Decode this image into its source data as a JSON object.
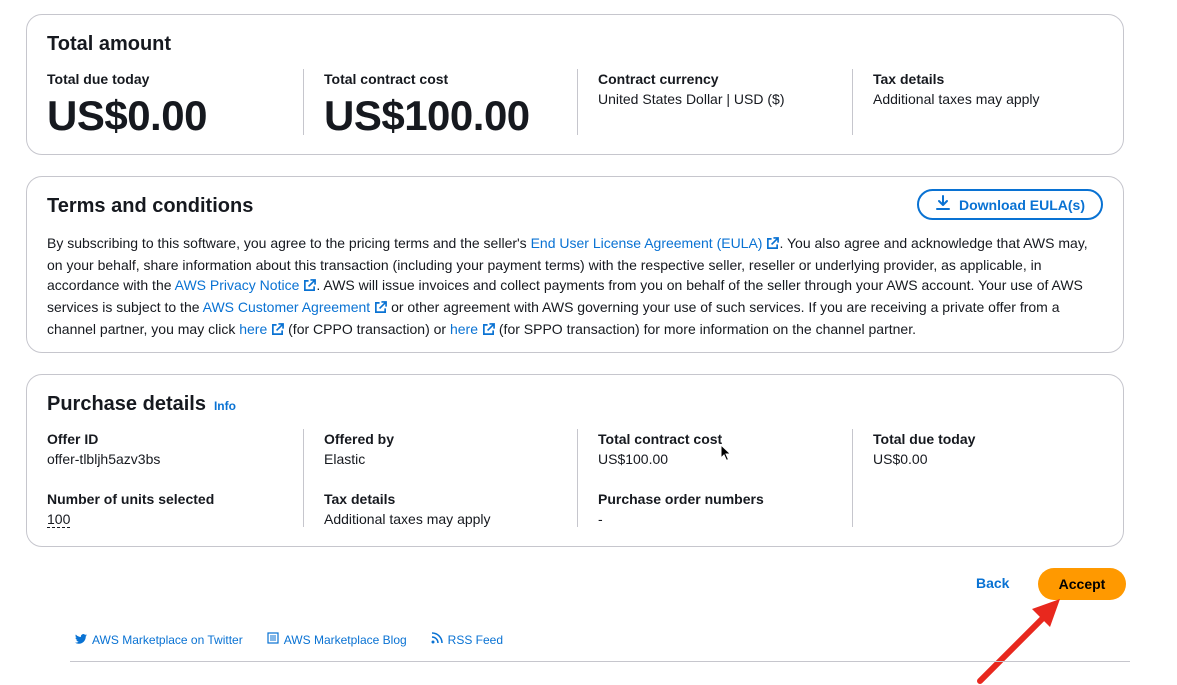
{
  "total_amount": {
    "title": "Total amount",
    "due_today_label": "Total due today",
    "due_today_value": "US$0.00",
    "contract_cost_label": "Total contract cost",
    "contract_cost_value": "US$100.00",
    "currency_label": "Contract currency",
    "currency_value": "United States Dollar | USD ($)",
    "tax_label": "Tax details",
    "tax_value": "Additional taxes may apply"
  },
  "terms": {
    "title": "Terms and conditions",
    "download_label": "Download EULA(s)",
    "t1": "By subscribing to this software, you agree to the pricing terms and the seller's ",
    "eula_link": "End User License Agreement (EULA)",
    "t2": ". You also agree and acknowledge that AWS may, on your behalf, share information about this transaction (including your payment terms) with the respective seller, reseller or underlying provider, as applicable, in accordance with the ",
    "privacy_link": "AWS Privacy Notice",
    "t3": ". AWS will issue invoices and collect payments from you on behalf of the seller through your AWS account. Your use of AWS services is subject to the ",
    "customer_link": "AWS Customer Agreement",
    "t4": " or other agreement with AWS governing your use of such services. If you are receiving a private offer from a channel partner, you may click ",
    "here1_link": "here",
    "t5": " (for CPPO transaction) or ",
    "here2_link": "here",
    "t6": " (for SPPO transaction) for more information on the channel partner."
  },
  "purchase": {
    "title": "Purchase details",
    "info_link": "Info",
    "offer_id_label": "Offer ID",
    "offer_id_value": "offer-tlbljh5azv3bs",
    "offered_by_label": "Offered by",
    "offered_by_value": "Elastic",
    "contract_cost_label": "Total contract cost",
    "contract_cost_value": "US$100.00",
    "due_today_label": "Total due today",
    "due_today_value": "US$0.00",
    "units_label": "Number of units selected",
    "units_value": "100",
    "tax_label": "Tax details",
    "tax_value": "Additional taxes may apply",
    "po_label": "Purchase order numbers",
    "po_value": "-"
  },
  "actions": {
    "back_label": "Back",
    "accept_label": "Accept"
  },
  "footer": {
    "twitter": "AWS Marketplace on Twitter",
    "blog": "AWS Marketplace Blog",
    "rss": "RSS Feed"
  },
  "colors": {
    "link": "#0972d3",
    "accept": "#ff9900",
    "arrow": "#e8281e"
  }
}
